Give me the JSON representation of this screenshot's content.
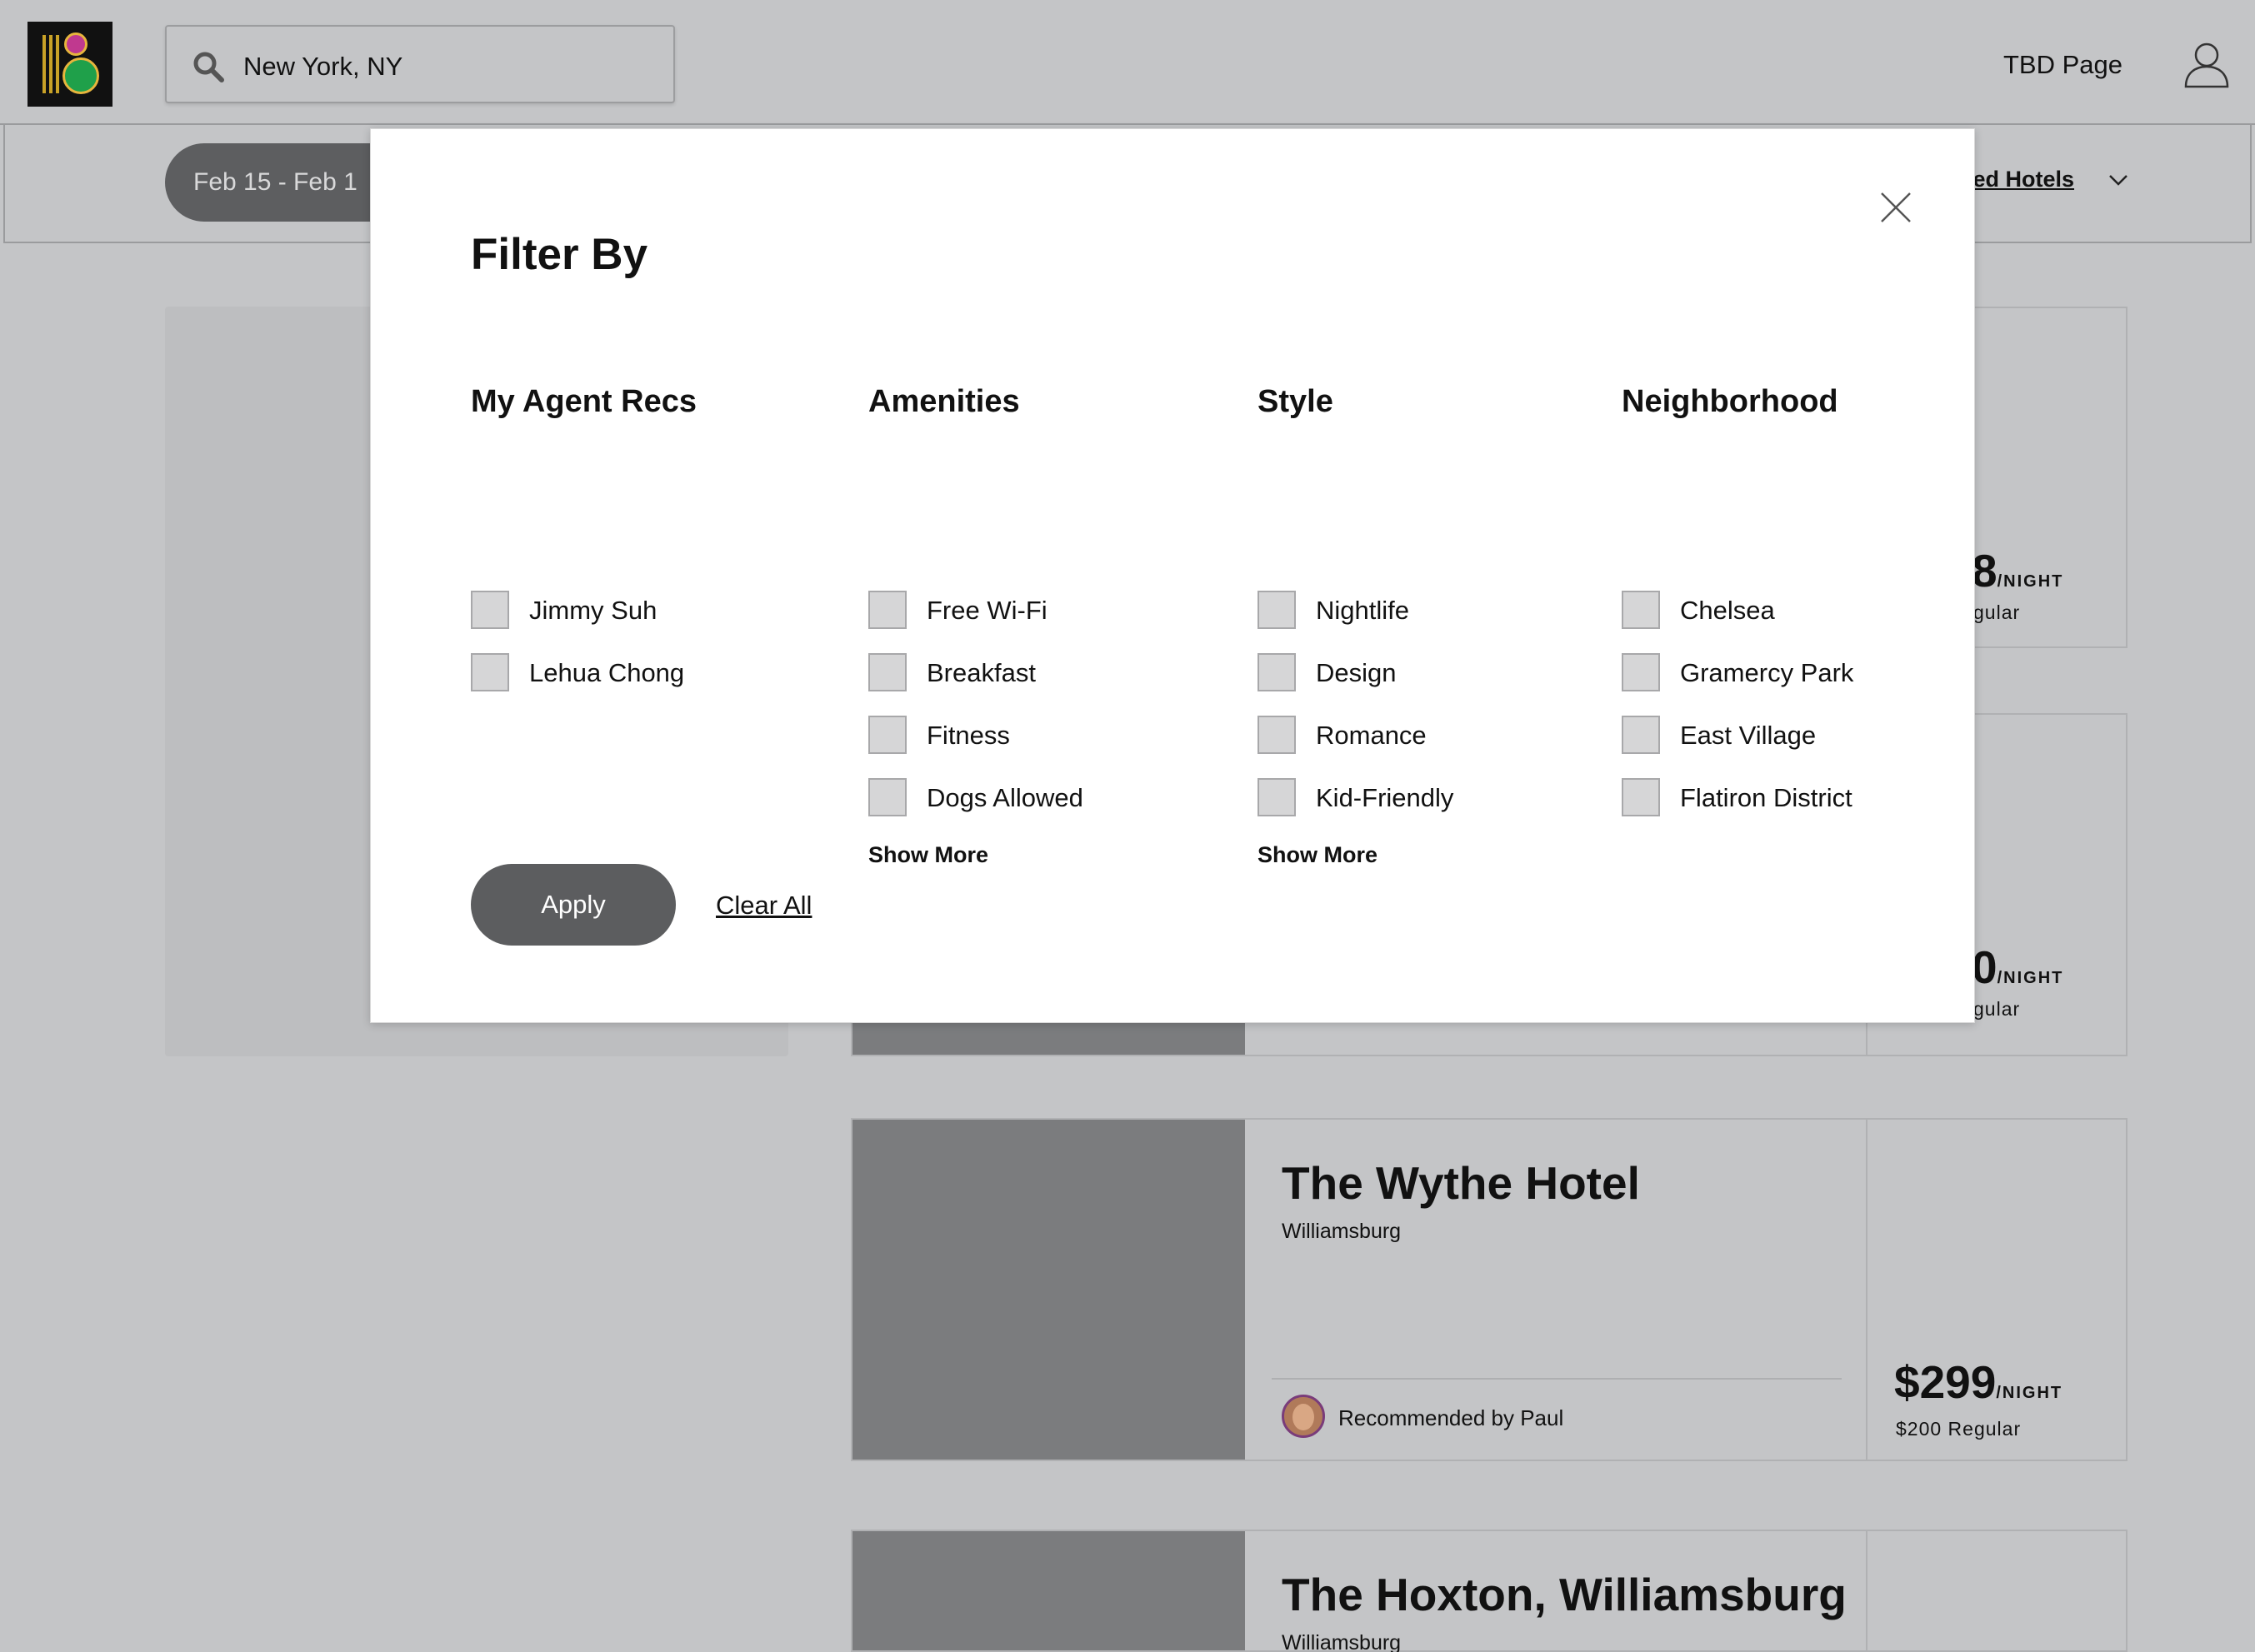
{
  "header": {
    "search_value": "New York, NY",
    "tbd_label": "TBD Page"
  },
  "filterbar": {
    "dates": "Feb 15 - Feb 1",
    "sort_label": "led Hotels"
  },
  "listings": [
    {
      "peek_price": "8",
      "peek_per": "/NIGHT",
      "peek_regular": "gular"
    },
    {
      "peek_price": "0",
      "peek_per": "/NIGHT",
      "peek_regular": "gular"
    },
    {
      "name": "The Wythe Hotel",
      "neighborhood": "Williamsburg",
      "recommended_by": "Recommended by Paul",
      "price": "$299",
      "per_night": "/NIGHT",
      "regular": "$200 Regular"
    },
    {
      "name": "The Hoxton, Williamsburg",
      "neighborhood": "Williamsburg"
    }
  ],
  "modal": {
    "title": "Filter By",
    "columns": [
      {
        "heading": "My Agent Recs",
        "options": [
          "Jimmy Suh",
          "Lehua Chong"
        ]
      },
      {
        "heading": "Amenities",
        "options": [
          "Free Wi-Fi",
          "Breakfast",
          "Fitness",
          "Dogs Allowed"
        ],
        "show_more": "Show More"
      },
      {
        "heading": "Style",
        "options": [
          "Nightlife",
          "Design",
          "Romance",
          "Kid-Friendly"
        ],
        "show_more": "Show More"
      },
      {
        "heading": "Neighborhood",
        "options": [
          "Chelsea",
          "Gramercy Park",
          "East Village",
          "Flatiron District"
        ]
      }
    ],
    "apply_label": "Apply",
    "clear_label": "Clear All"
  }
}
